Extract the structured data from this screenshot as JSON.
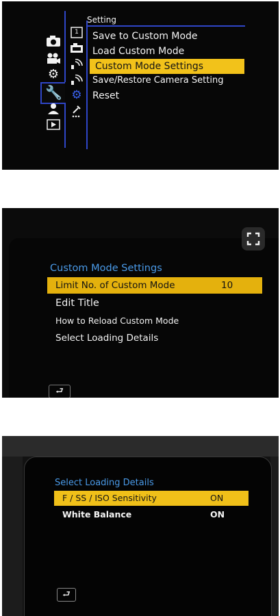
{
  "panel1": {
    "section_title": "Setting",
    "menu_items": [
      "Save to Custom Mode",
      "Load Custom Mode",
      "Custom Mode Settings",
      "Save/Restore Camera Setting",
      "Reset"
    ],
    "selected_index": 2,
    "main_tab_icons": [
      "camera-icon",
      "video-icon",
      "gear-icon",
      "wrench-icon",
      "person-icon",
      "playback-icon"
    ],
    "sub_tab_icons": [
      "custom-mode-icon",
      "camera-icon",
      "wireless-icon",
      "wireless-icon",
      "gear-icon",
      "wrench-dots-icon"
    ]
  },
  "panel2": {
    "header": "Custom Mode Settings",
    "selected_item": {
      "label": "Limit No. of Custom Mode",
      "value": "10"
    },
    "items": [
      "Edit Title",
      "How to Reload Custom Mode",
      "Select Loading Details"
    ],
    "icons": [
      "expand-icon",
      "back-icon"
    ]
  },
  "panel3": {
    "header": "Select Loading Details",
    "selected_item": {
      "label": "F / SS / ISO Sensitivity",
      "value": "ON"
    },
    "items": [
      {
        "label": "White Balance",
        "value": "ON"
      }
    ],
    "icons": [
      "back-icon"
    ]
  },
  "colors": {
    "highlight": "#f2c21a",
    "menu_border_blue": "#2f46c8",
    "header_blue": "#4a9ae8",
    "screen_bg": "#070707"
  }
}
